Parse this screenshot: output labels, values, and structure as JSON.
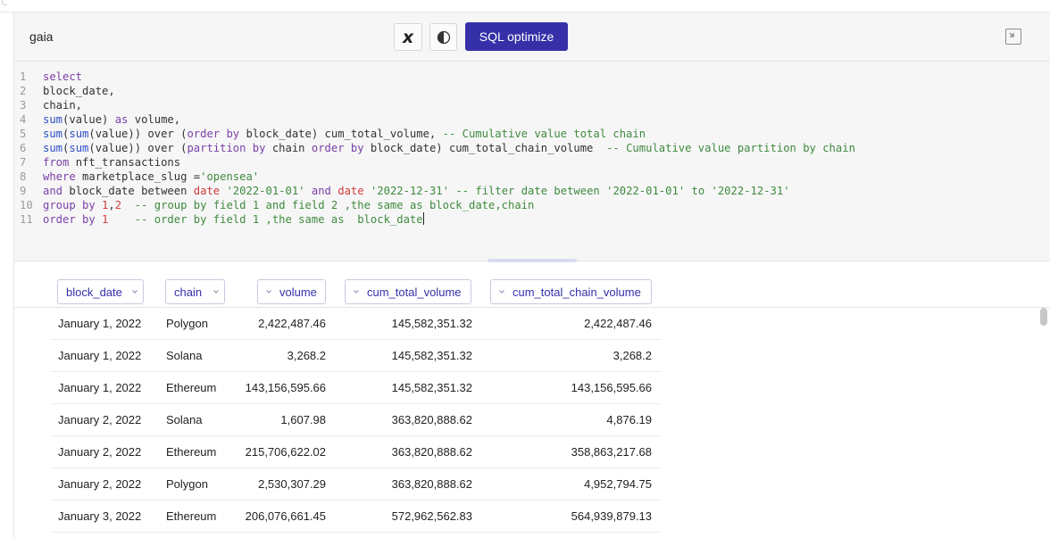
{
  "panel": {
    "title": "gaia",
    "sql_optimize_label": "SQL optimize"
  },
  "editor": {
    "line_numbers": [
      "1",
      "2",
      "3",
      "4",
      "5",
      "6",
      "7",
      "8",
      "9",
      "10",
      "11"
    ]
  },
  "table": {
    "columns": [
      "block_date",
      "chain",
      "volume",
      "cum_total_volume",
      "cum_total_chain_volume"
    ],
    "rows": [
      [
        "January 1, 2022",
        "Polygon",
        "2,422,487.46",
        "145,582,351.32",
        "2,422,487.46"
      ],
      [
        "January 1, 2022",
        "Solana",
        "3,268.2",
        "145,582,351.32",
        "3,268.2"
      ],
      [
        "January 1, 2022",
        "Ethereum",
        "143,156,595.66",
        "145,582,351.32",
        "143,156,595.66"
      ],
      [
        "January 2, 2022",
        "Solana",
        "1,607.98",
        "363,820,888.62",
        "4,876.19"
      ],
      [
        "January 2, 2022",
        "Ethereum",
        "215,706,622.02",
        "363,820,888.62",
        "358,863,217.68"
      ],
      [
        "January 2, 2022",
        "Polygon",
        "2,530,307.29",
        "363,820,888.62",
        "4,952,794.75"
      ],
      [
        "January 3, 2022",
        "Ethereum",
        "206,076,661.45",
        "572,962,562.83",
        "564,939,879.13"
      ]
    ]
  },
  "colors": {
    "accent": "#3530a8",
    "keyword": "#7a3fa8",
    "function": "#2c4fc9",
    "string": "#3f8a3f",
    "number": "#d23b3b",
    "comment": "#3f8a3f"
  }
}
